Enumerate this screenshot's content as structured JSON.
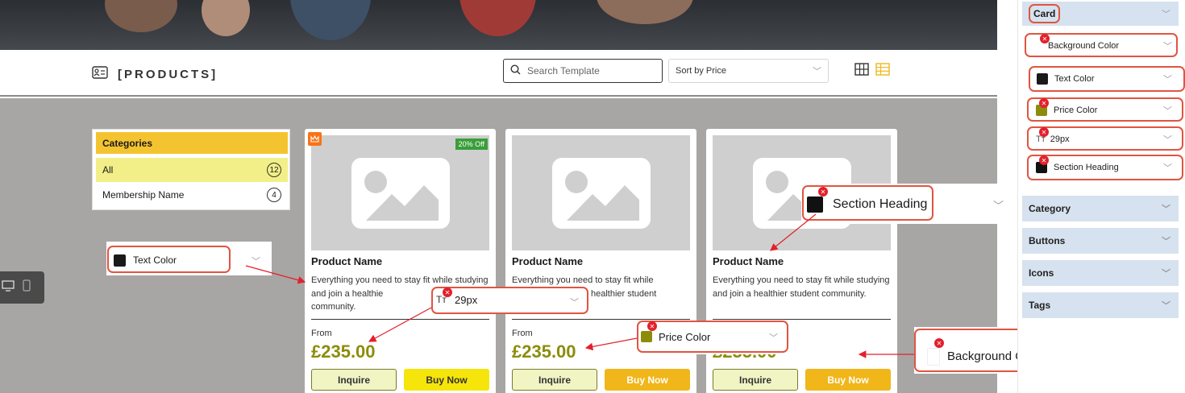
{
  "header": {
    "brand": "[PRODUCTS]",
    "search_placeholder": "Search Template",
    "sort_label": "Sort by Price"
  },
  "categories": {
    "title": "Categories",
    "items": [
      {
        "label": "All",
        "count": "12"
      },
      {
        "label": "Membership Name",
        "count": "4"
      }
    ]
  },
  "cards": [
    {
      "name": "Product Name",
      "desc": "Everything you need to stay fit while studying and join a healthie",
      "desc_tail": "community.",
      "from": "From",
      "price": "£235.00",
      "inquire": "Inquire",
      "buy": "Buy Now",
      "badge": "20% Off"
    },
    {
      "name": "Product Name",
      "desc": "Everything you need to stay fit while",
      "desc_tail": "healthier student",
      "from": "From",
      "price": "£235.00",
      "inquire": "Inquire",
      "buy": "Buy Now"
    },
    {
      "name": "Product Name",
      "desc": "Everything you need to stay fit while studying and join a healthier student community.",
      "from": "",
      "price": "£235.00",
      "inquire": "Inquire",
      "buy": "Buy Now"
    }
  ],
  "callouts": {
    "text_color": "Text Color",
    "font_size": "29px",
    "price_color": "Price Color",
    "section_heading": "Section Heading",
    "background_color": "Background Color"
  },
  "panel": {
    "card_title": "Card",
    "rows": [
      "Background Color",
      "Text Color",
      "Price Color",
      "29px",
      "Section Heading"
    ],
    "sections": [
      "Category",
      "Buttons",
      "Icons",
      "Tags"
    ]
  },
  "colors": {
    "accent_yellow": "#f4c430",
    "price_olive": "#8c8c0a",
    "annotation_red": "#e05541",
    "panel_blue": "#d6e2ef"
  }
}
